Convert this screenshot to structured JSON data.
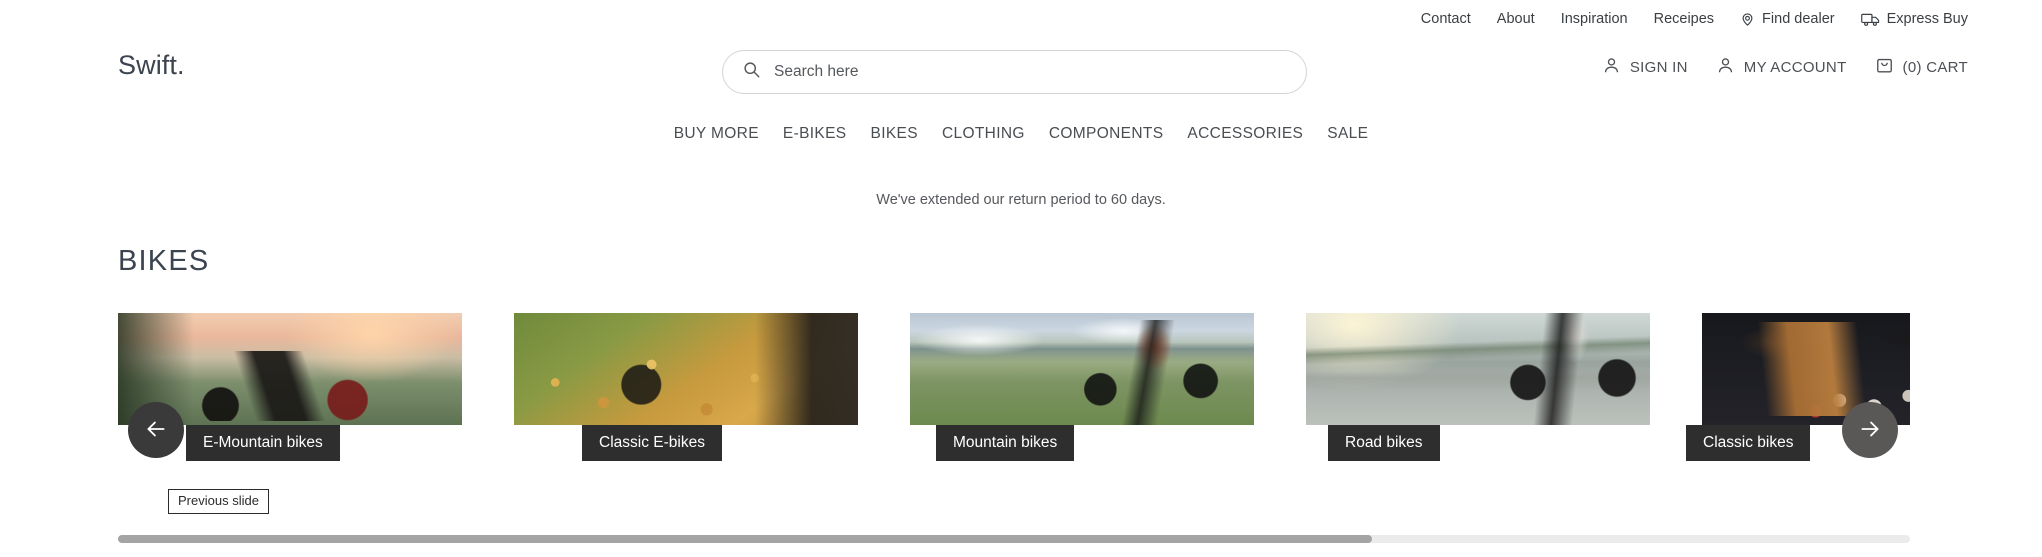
{
  "utility_nav": {
    "items": [
      {
        "label": "Contact",
        "icon": null
      },
      {
        "label": "About",
        "icon": null
      },
      {
        "label": "Inspiration",
        "icon": null
      },
      {
        "label": "Receipes",
        "icon": null
      },
      {
        "label": "Find dealer",
        "icon": "location-pin-icon"
      },
      {
        "label": "Express Buy",
        "icon": "delivery-truck-icon"
      }
    ]
  },
  "header": {
    "logo": "Swift.",
    "search": {
      "placeholder": "Search here",
      "value": "",
      "icon": "search-icon"
    },
    "account": [
      {
        "label": "SIGN IN",
        "icon": "user-icon"
      },
      {
        "label": "MY ACCOUNT",
        "icon": "user-icon"
      },
      {
        "label": "(0) CART",
        "icon": "shopping-bag-icon",
        "count": 0
      }
    ]
  },
  "main_nav": {
    "items": [
      "BUY MORE",
      "E-BIKES",
      "BIKES",
      "CLOTHING",
      "COMPONENTS",
      "ACCESSORIES",
      "SALE"
    ]
  },
  "announcement": "We've extended our return period to 60 days.",
  "page_title": "BIKES",
  "carousel": {
    "cards": [
      {
        "label": "E-Mountain bikes",
        "image_alt": "Black e-mountain bike with red rims at sunset overlooking hills"
      },
      {
        "label": "Classic E-bikes",
        "image_alt": "Classic e-bike front wheel on a path covered in autumn leaves"
      },
      {
        "label": "Mountain bikes",
        "image_alt": "Cyclist on a mountain bike in a grassy meadow above a valley"
      },
      {
        "label": "Road bikes",
        "image_alt": "Road cyclist riding on sunlit asphalt road"
      },
      {
        "label": "Classic bikes",
        "image_alt": "Classic bike handlebars and saddle with night bokeh lights"
      }
    ],
    "prev_button": {
      "label": "Previous slide",
      "icon": "arrow-left-icon"
    },
    "next_button": {
      "label": "Next slide",
      "icon": "arrow-right-icon"
    },
    "tooltip": "Previous slide",
    "scroll_percent": 70
  },
  "colors": {
    "logo": "#3c4450",
    "label_chip_bg": "#2e2e2e",
    "prev_arrow_bg": "#3a3a3a",
    "next_arrow_bg": "#5a5857",
    "scroll_thumb": "#a4a4a4",
    "scroll_track": "#ebebeb"
  }
}
